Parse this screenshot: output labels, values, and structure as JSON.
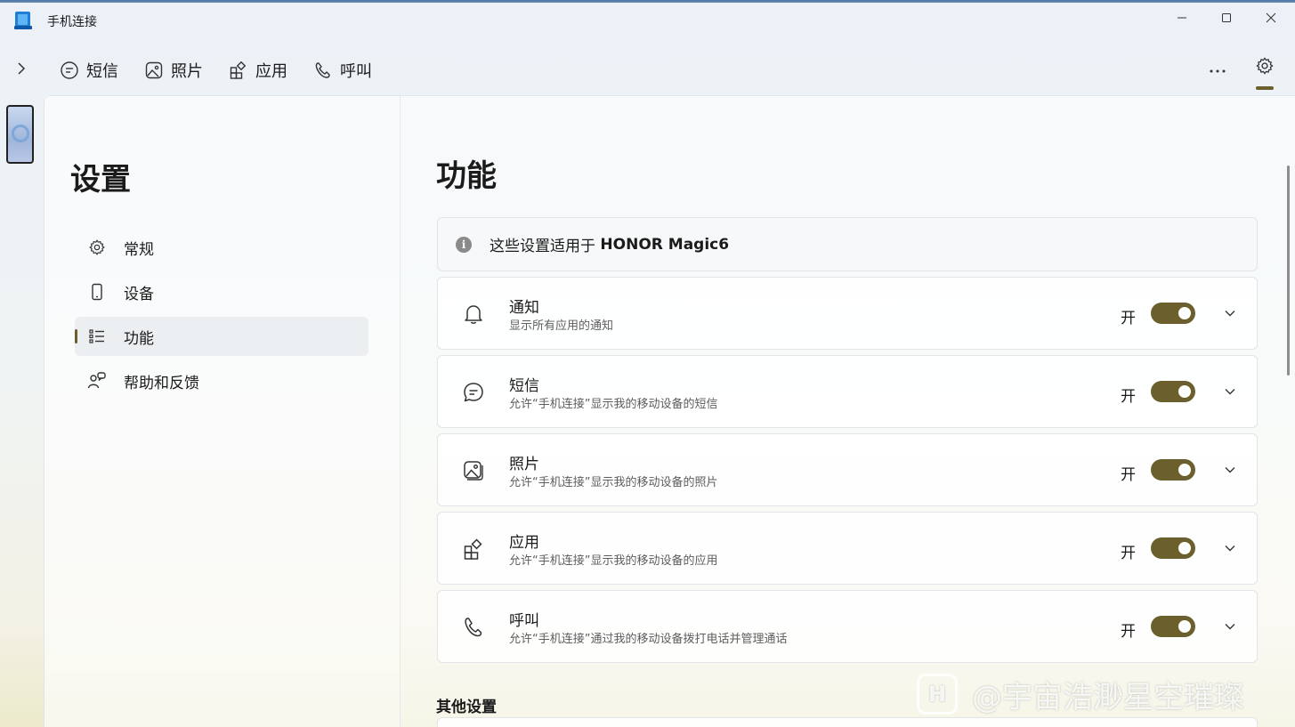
{
  "window": {
    "title": "手机连接"
  },
  "nav": {
    "tabs": [
      {
        "label": "短信",
        "icon": "message-icon"
      },
      {
        "label": "照片",
        "icon": "photo-icon"
      },
      {
        "label": "应用",
        "icon": "apps-icon"
      },
      {
        "label": "呼叫",
        "icon": "phone-icon"
      }
    ],
    "more": "···"
  },
  "sidebar": {
    "title": "设置",
    "items": [
      {
        "label": "常规",
        "icon": "gear-icon"
      },
      {
        "label": "设备",
        "icon": "device-icon"
      },
      {
        "label": "功能",
        "icon": "list-icon",
        "active": true
      },
      {
        "label": "帮助和反馈",
        "icon": "help-feedback-icon"
      }
    ]
  },
  "main": {
    "title": "功能",
    "info_text": "这些设置适用于 ",
    "info_device": "HONOR Magic6",
    "info_icon": "i",
    "features": [
      {
        "title": "通知",
        "desc": "显示所有应用的通知",
        "state": "开",
        "on": true,
        "icon": "bell-icon"
      },
      {
        "title": "短信",
        "desc": "允许“手机连接”显示我的移动设备的短信",
        "state": "开",
        "on": true,
        "icon": "message-icon"
      },
      {
        "title": "照片",
        "desc": "允许“手机连接”显示我的移动设备的照片",
        "state": "开",
        "on": true,
        "icon": "photo-icon"
      },
      {
        "title": "应用",
        "desc": "允许“手机连接”显示我的移动设备的应用",
        "state": "开",
        "on": true,
        "icon": "apps-icon"
      },
      {
        "title": "呼叫",
        "desc": "允许“手机连接”通过我的移动设备拨打电话并管理通话",
        "state": "开",
        "on": true,
        "icon": "phone-icon"
      }
    ],
    "other_title": "其他设置"
  },
  "watermark": {
    "logo": "H",
    "text": "@宇宙浩渺星空璀璨"
  },
  "colors": {
    "accent": "#6b5f2c",
    "text": "#1b1b1b",
    "desc": "#5d5d5d"
  }
}
